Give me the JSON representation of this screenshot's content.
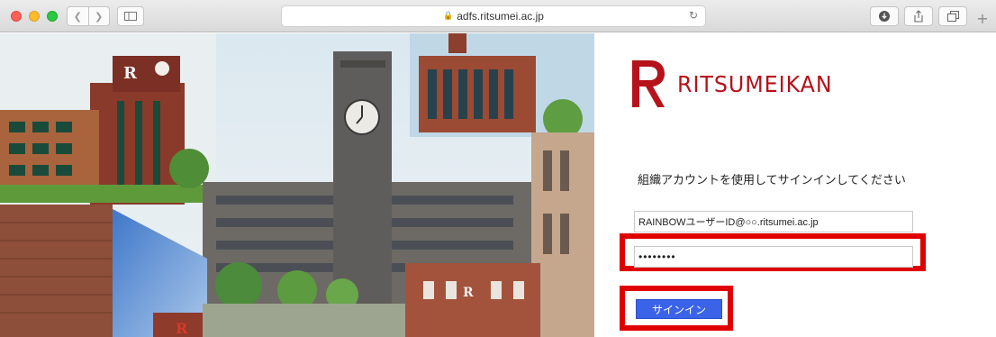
{
  "browser": {
    "url": "adfs.ritsumei.ac.jp",
    "traffic_lights": {
      "close": "#fc5f57",
      "minimize": "#fdbc2e",
      "zoom": "#29c940"
    }
  },
  "page": {
    "logo_text": "RITSUMEIKAN",
    "instruction": "組織アカウントを使用してサインインしてください",
    "email_value": "RAINBOWユーザーID@○○.ritsumei.ac.jp",
    "password_value": "••••••••",
    "signin_label": "サインイン",
    "brand_color": "#b5121b",
    "button_color": "#3b63e8",
    "highlight_color": "#e00000"
  }
}
